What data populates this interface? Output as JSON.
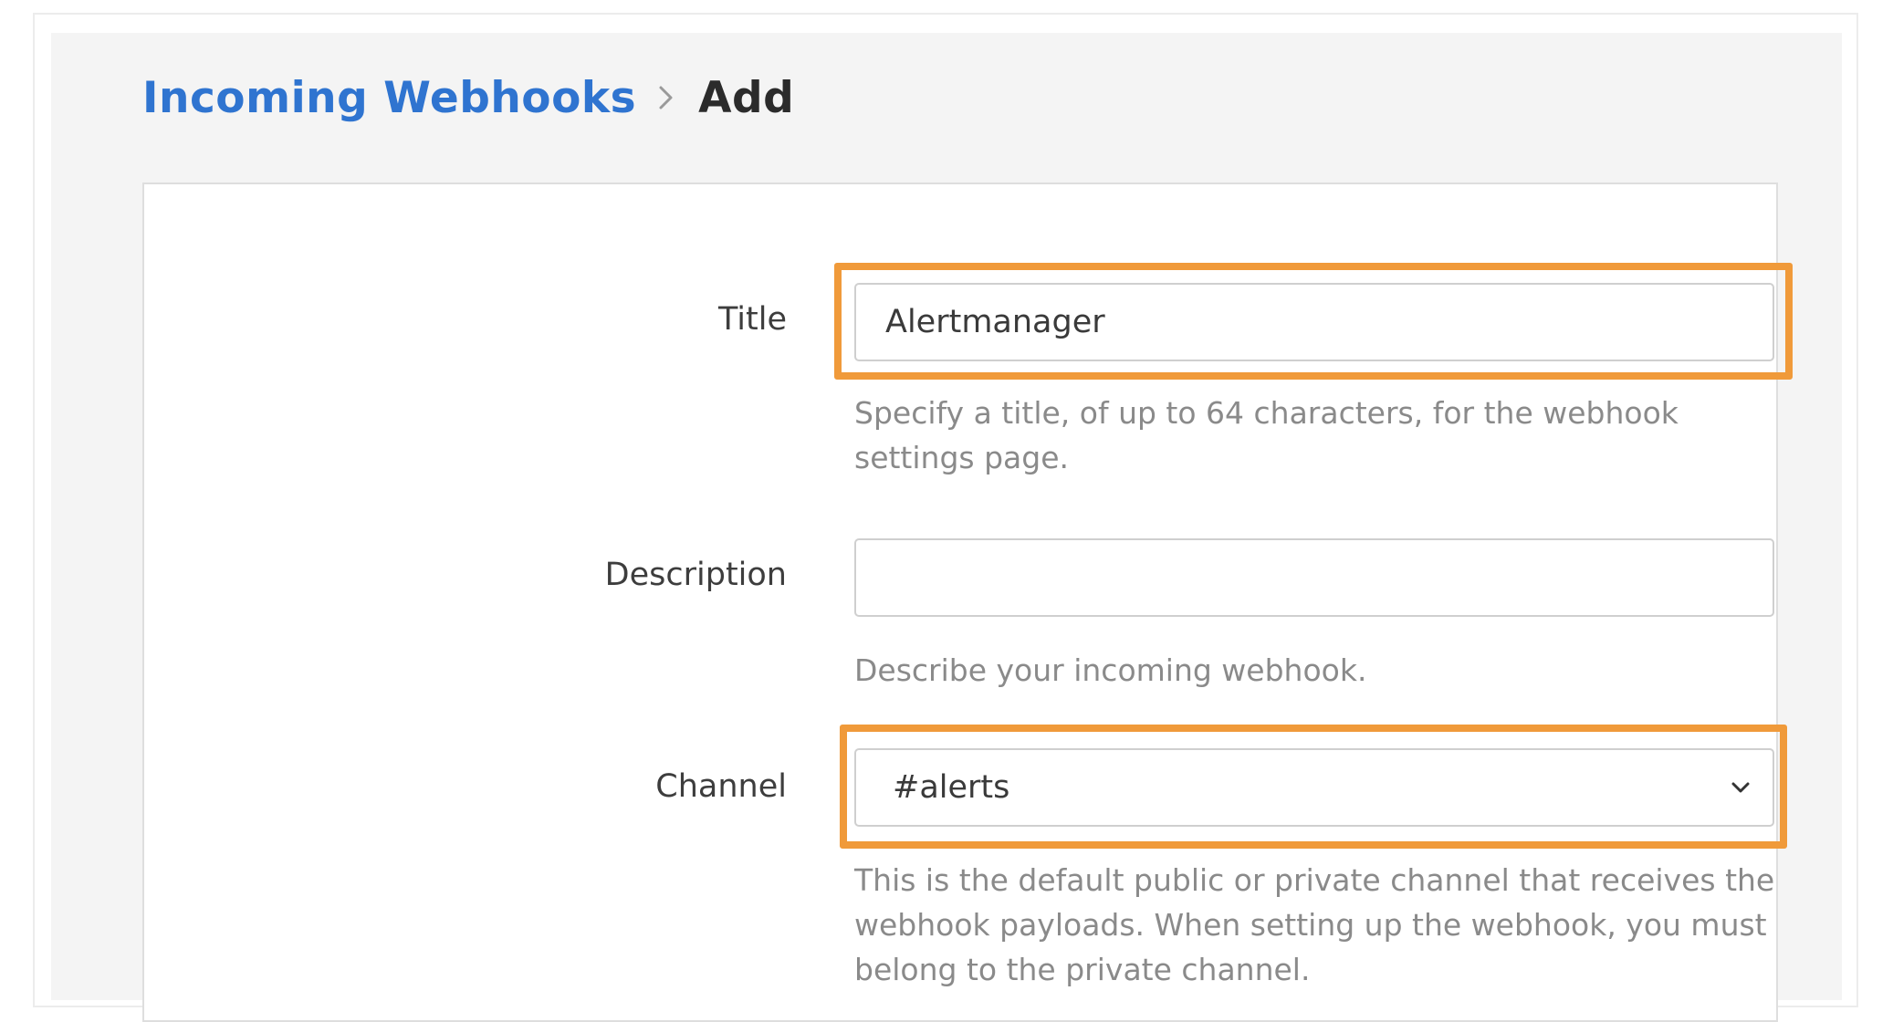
{
  "breadcrumb": {
    "parent": "Incoming Webhooks",
    "current": "Add"
  },
  "form": {
    "title": {
      "label": "Title",
      "value": "Alertmanager",
      "help": "Specify a title, of up to 64 characters, for the webhook settings page."
    },
    "description": {
      "label": "Description",
      "value": "",
      "help": "Describe your incoming webhook."
    },
    "channel": {
      "label": "Channel",
      "selected": "#alerts",
      "help": "This is the default public or private channel that receives the webhook payloads. When setting up the webhook, you must belong to the private channel."
    }
  },
  "colors": {
    "link": "#2f74d0",
    "highlight": "#f09a3a"
  },
  "icons": {
    "breadcrumb_separator": "chevron-right-icon",
    "select_arrow": "chevron-down-icon"
  }
}
